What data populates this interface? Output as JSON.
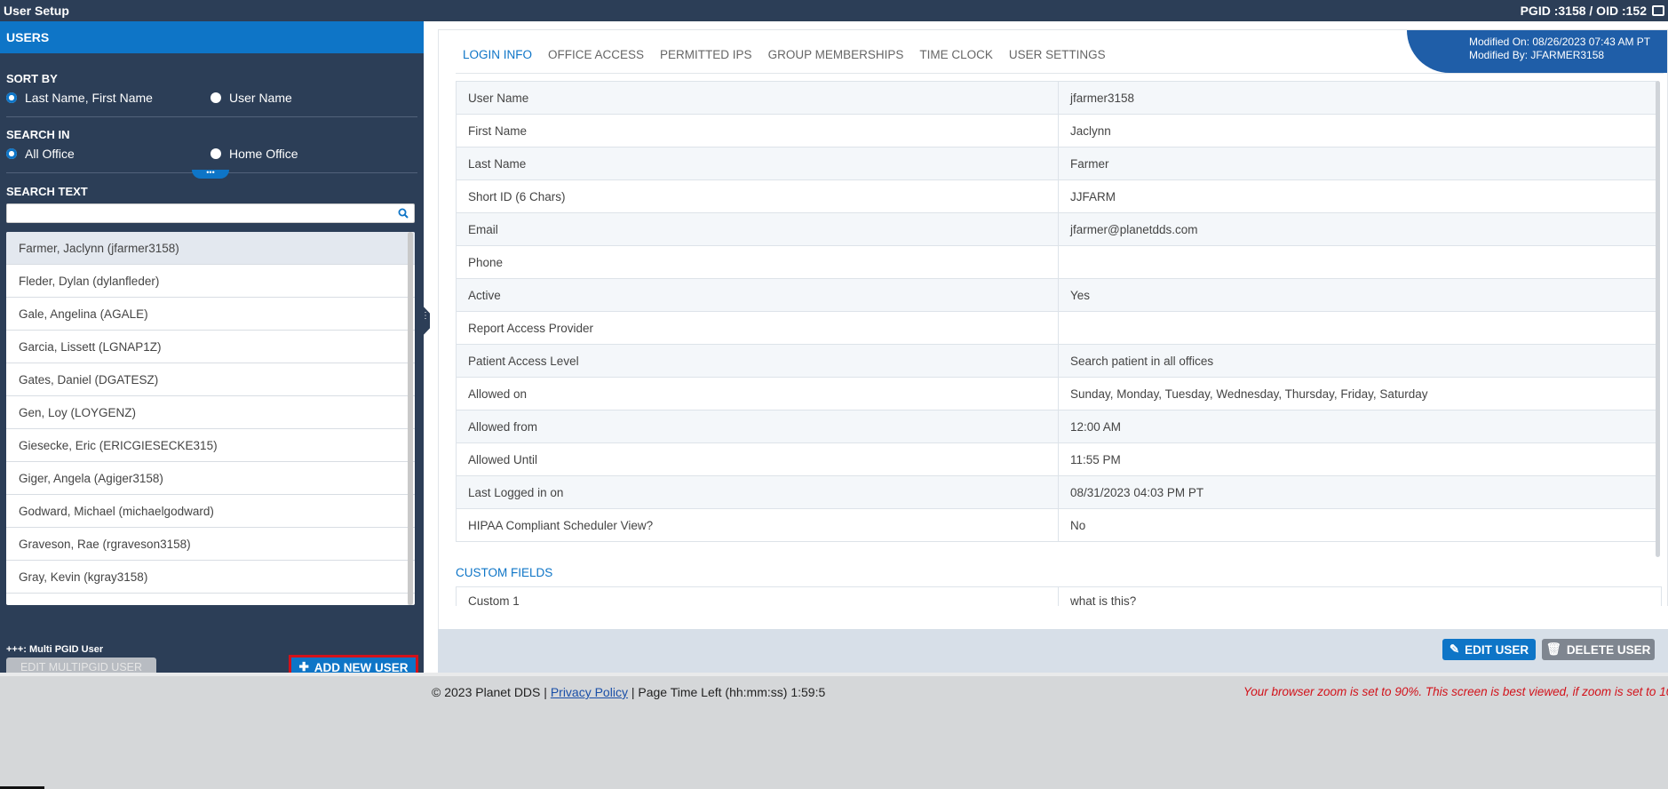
{
  "topbar": {
    "title": "User Setup",
    "ids": "PGID :3158  /  OID :152"
  },
  "sidebar": {
    "header": "USERS",
    "sort_by": {
      "label": "SORT BY",
      "options": [
        "Last Name, First Name",
        "User Name"
      ]
    },
    "search_in": {
      "label": "SEARCH IN",
      "options": [
        "All Office",
        "Home Office"
      ]
    },
    "search_text": {
      "label": "SEARCH TEXT",
      "value": "",
      "placeholder": ""
    },
    "collapse_glyph": "•••",
    "users": [
      "Farmer, Jaclynn (jfarmer3158)",
      "Fleder, Dylan (dylanfleder)",
      "Gale, Angelina (AGALE)",
      "Garcia, Lissett (LGNAP1Z)",
      "Gates, Daniel (DGATESZ)",
      "Gen, Loy (LOYGENZ)",
      "Giesecke, Eric (ERICGIESECKE315)",
      "Giger, Angela (Agiger3158)",
      "Godward, Michael (michaelgodward)",
      "Graveson, Rae (rgraveson3158)",
      "Gray, Kevin (kgray3158)"
    ],
    "multi_label": "+++: Multi PGID User",
    "edit_multi": "EDIT MULTIPGID USER",
    "add_user": "ADD NEW USER"
  },
  "main": {
    "tabs": [
      "LOGIN INFO",
      "OFFICE ACCESS",
      "PERMITTED IPS",
      "GROUP MEMBERSHIPS",
      "TIME CLOCK",
      "USER SETTINGS"
    ],
    "modified_on": "Modified On: 08/26/2023 07:43 AM PT",
    "modified_by": "Modified By: JFARMER3158",
    "details": [
      {
        "label": "User Name",
        "value": "jfarmer3158"
      },
      {
        "label": "First Name",
        "value": "Jaclynn"
      },
      {
        "label": "Last Name",
        "value": "Farmer"
      },
      {
        "label": "Short ID (6 Chars)",
        "value": "JJFARM"
      },
      {
        "label": "Email",
        "value": "jfarmer@planetdds.com"
      },
      {
        "label": "Phone",
        "value": ""
      },
      {
        "label": "Active",
        "value": "Yes"
      },
      {
        "label": "Report Access Provider",
        "value": ""
      },
      {
        "label": "Patient Access Level",
        "value": "Search patient in all offices"
      },
      {
        "label": "Allowed on",
        "value": "Sunday, Monday, Tuesday, Wednesday, Thursday, Friday, Saturday"
      },
      {
        "label": "Allowed from",
        "value": "12:00 AM"
      },
      {
        "label": "Allowed Until",
        "value": "11:55 PM"
      },
      {
        "label": "Last Logged in on",
        "value": "08/31/2023 04:03 PM PT"
      },
      {
        "label": "HIPAA Compliant Scheduler View?",
        "value": "No"
      }
    ],
    "custom_title": "CUSTOM FIELDS",
    "custom": [
      {
        "label": "Custom 1",
        "value": "what is this?"
      }
    ],
    "edit_user": "EDIT USER",
    "delete_user": "DELETE USER"
  },
  "footer": {
    "copyright": "© 2023 Planet DDS |",
    "privacy": "Privacy Policy",
    "page_time": "| Page Time Left (hh:mm:ss) 1:59:5",
    "zoom_warning": "Your browser zoom is set to 90%. This screen is best viewed, if zoom is set to 10"
  },
  "colors": {
    "navy": "#2c3e57",
    "accent": "#0e75c7",
    "highlight": "#d2121a"
  }
}
